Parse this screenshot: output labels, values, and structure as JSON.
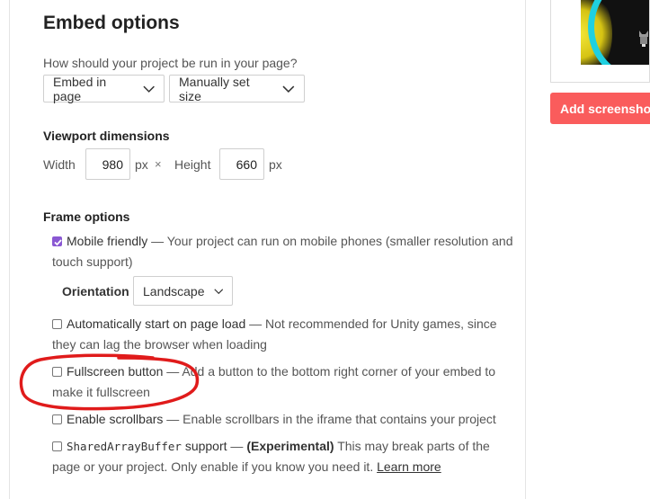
{
  "embed": {
    "heading": "Embed options",
    "question": "How should your project be run in your page?",
    "run_mode": {
      "selected": "Embed in page",
      "icon": "chevron-down-icon"
    },
    "size_mode": {
      "selected": "Manually set size",
      "icon": "chevron-down-icon"
    }
  },
  "viewport": {
    "heading": "Viewport dimensions",
    "width_label": "Width",
    "width_value": "980",
    "width_unit": "px",
    "times_symbol": "×",
    "height_label": "Height",
    "height_value": "660",
    "height_unit": "px"
  },
  "frame": {
    "heading": "Frame options",
    "mobile": {
      "checked": true,
      "title": "Mobile friendly",
      "desc": " — Your project can run on mobile phones (smaller resolution and touch support)"
    },
    "orientation": {
      "label": "Orientation",
      "selected": "Landscape",
      "icon": "chevron-down-icon"
    },
    "autostart": {
      "checked": false,
      "title": "Automatically start on page load",
      "desc": " — Not recommended for Unity games, since they can lag the browser when loading"
    },
    "fullscreen": {
      "checked": false,
      "title": "Fullscreen button",
      "desc": " — Add a button to the bottom right corner of your embed to make it fullscreen"
    },
    "scrollbars": {
      "checked": false,
      "title": "Enable scrollbars",
      "desc": " — Enable scrollbars in the iframe that contains your project"
    },
    "sab": {
      "checked": false,
      "code": "SharedArrayBuffer",
      "title_suffix": " support",
      "dash": " — ",
      "experimental": "(Experimental)",
      "desc": " This may break parts of the page or your project. Only enable if you know you need it. ",
      "link": "Learn more"
    }
  },
  "sidebar": {
    "add_screenshots": "Add screenshots",
    "thumbnail_icon": "game-thumbnail"
  },
  "colors": {
    "accent_checkbox": "#8a58d3",
    "add_button": "#fa5c5c",
    "annotation": "#e01b1b"
  }
}
